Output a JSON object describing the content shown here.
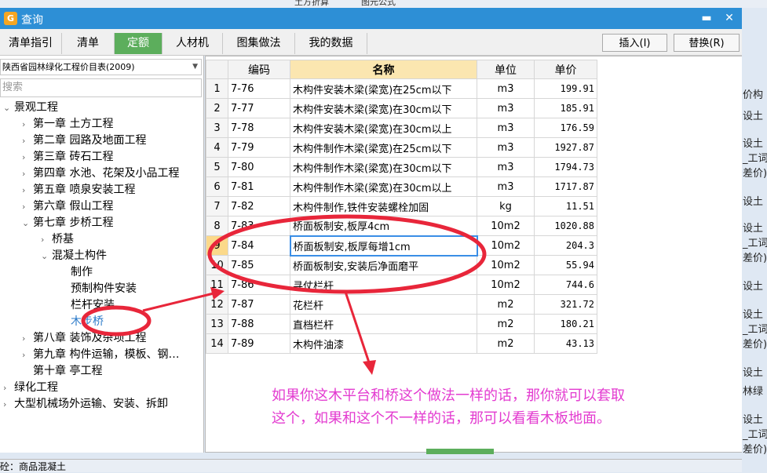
{
  "top_strip_fragments": [
    "土方折算",
    "图元公式"
  ],
  "window": {
    "title": "查询",
    "app_icon": "app-logo-icon",
    "minimize_icon": "minimize-icon",
    "close_icon": "close-icon"
  },
  "tabs": [
    {
      "label": "清单指引",
      "active": false
    },
    {
      "label": "清单",
      "active": false
    },
    {
      "label": "定额",
      "active": true
    },
    {
      "label": "人材机",
      "active": false
    },
    {
      "label": "图集做法",
      "active": false
    },
    {
      "label": "我的数据",
      "active": false
    }
  ],
  "actions": {
    "insert_label": "插入(I)",
    "replace_label": "替换(R)"
  },
  "left": {
    "library_select": "陕西省园林绿化工程价目表(2009)",
    "search_placeholder": "搜索",
    "tree": [
      {
        "label": "景观工程",
        "state": "expanded"
      },
      {
        "label": "第一章  土方工程",
        "state": "collapsed"
      },
      {
        "label": "第二章  园路及地面工程",
        "state": "collapsed"
      },
      {
        "label": "第三章  砖石工程",
        "state": "collapsed"
      },
      {
        "label": "第四章  水池、花架及小品工程",
        "state": "collapsed"
      },
      {
        "label": "第五章  喷泉安装工程",
        "state": "collapsed"
      },
      {
        "label": "第六章  假山工程",
        "state": "collapsed"
      },
      {
        "label": "第七章  步桥工程",
        "state": "expanded"
      },
      {
        "label": "桥基",
        "state": "collapsed"
      },
      {
        "label": "混凝土构件",
        "state": "expanded"
      },
      {
        "label": "制作",
        "state": "leaf"
      },
      {
        "label": "预制构件安装",
        "state": "leaf"
      },
      {
        "label": "栏杆安装",
        "state": "leaf"
      },
      {
        "label": "木步桥",
        "state": "selected"
      },
      {
        "label": "第八章  装饰及杂项工程",
        "state": "collapsed"
      },
      {
        "label": "第九章  构件运输，模板、钢…",
        "state": "collapsed"
      },
      {
        "label": "第十章  亭工程",
        "state": "leaf"
      },
      {
        "label": "绿化工程",
        "state": "collapsed"
      },
      {
        "label": "大型机械场外运输、安装、拆卸",
        "state": "collapsed"
      }
    ]
  },
  "grid": {
    "headers": {
      "code": "编码",
      "name": "名称",
      "unit": "单位",
      "price": "单价"
    },
    "rows": [
      {
        "n": "1",
        "code": "7-76",
        "name": "木构件安装木梁(梁宽)在25cm以下",
        "unit": "m3",
        "price": "199.91"
      },
      {
        "n": "2",
        "code": "7-77",
        "name": "木构件安装木梁(梁宽)在30cm以下",
        "unit": "m3",
        "price": "185.91"
      },
      {
        "n": "3",
        "code": "7-78",
        "name": "木构件安装木梁(梁宽)在30cm以上",
        "unit": "m3",
        "price": "176.59"
      },
      {
        "n": "4",
        "code": "7-79",
        "name": "木构件制作木梁(梁宽)在25cm以下",
        "unit": "m3",
        "price": "1927.87"
      },
      {
        "n": "5",
        "code": "7-80",
        "name": "木构件制作木梁(梁宽)在30cm以下",
        "unit": "m3",
        "price": "1794.73"
      },
      {
        "n": "6",
        "code": "7-81",
        "name": "木构件制作木梁(梁宽)在30cm以上",
        "unit": "m3",
        "price": "1717.87"
      },
      {
        "n": "7",
        "code": "7-82",
        "name": "木构件制作,铁件安装螺栓加固",
        "unit": "kg",
        "price": "11.51"
      },
      {
        "n": "8",
        "code": "7-83",
        "name": "桥面板制安,板厚4cm",
        "unit": "10m2",
        "price": "1020.88"
      },
      {
        "n": "9",
        "code": "7-84",
        "name": "桥面板制安,板厚每增1cm",
        "unit": "10m2",
        "price": "204.3"
      },
      {
        "n": "10",
        "code": "7-85",
        "name": "桥面板制安,安装后净面磨平",
        "unit": "10m2",
        "price": "55.94"
      },
      {
        "n": "11",
        "code": "7-86",
        "name": "寻仗栏杆",
        "unit": "10m2",
        "price": "744.6"
      },
      {
        "n": "12",
        "code": "7-87",
        "name": "花栏杆",
        "unit": "m2",
        "price": "321.72"
      },
      {
        "n": "13",
        "code": "7-88",
        "name": "直档栏杆",
        "unit": "m2",
        "price": "180.21"
      },
      {
        "n": "14",
        "code": "7-89",
        "name": "木构件油漆",
        "unit": "m2",
        "price": "43.13"
      }
    ],
    "current_row": 9
  },
  "annotation": {
    "line1": "如果你这木平台和桥这个做法一样的话，那你就可以套取",
    "line2": "这个，如果和这个不一样的话，那可以看看木板地面。",
    "color": "#e33bd0",
    "ink_color": "#e8263a"
  },
  "right_side_fragments": [
    "价构",
    "设土",
    "设土",
    "_工词",
    "差价)",
    "设土",
    "设土",
    "_工词",
    "差价)",
    "设土",
    "设土",
    "_工词",
    "差价)",
    "设土",
    "林绿",
    "设土",
    "_工词",
    "差价)"
  ],
  "bottom_strip_text": "砼：商品混凝土"
}
